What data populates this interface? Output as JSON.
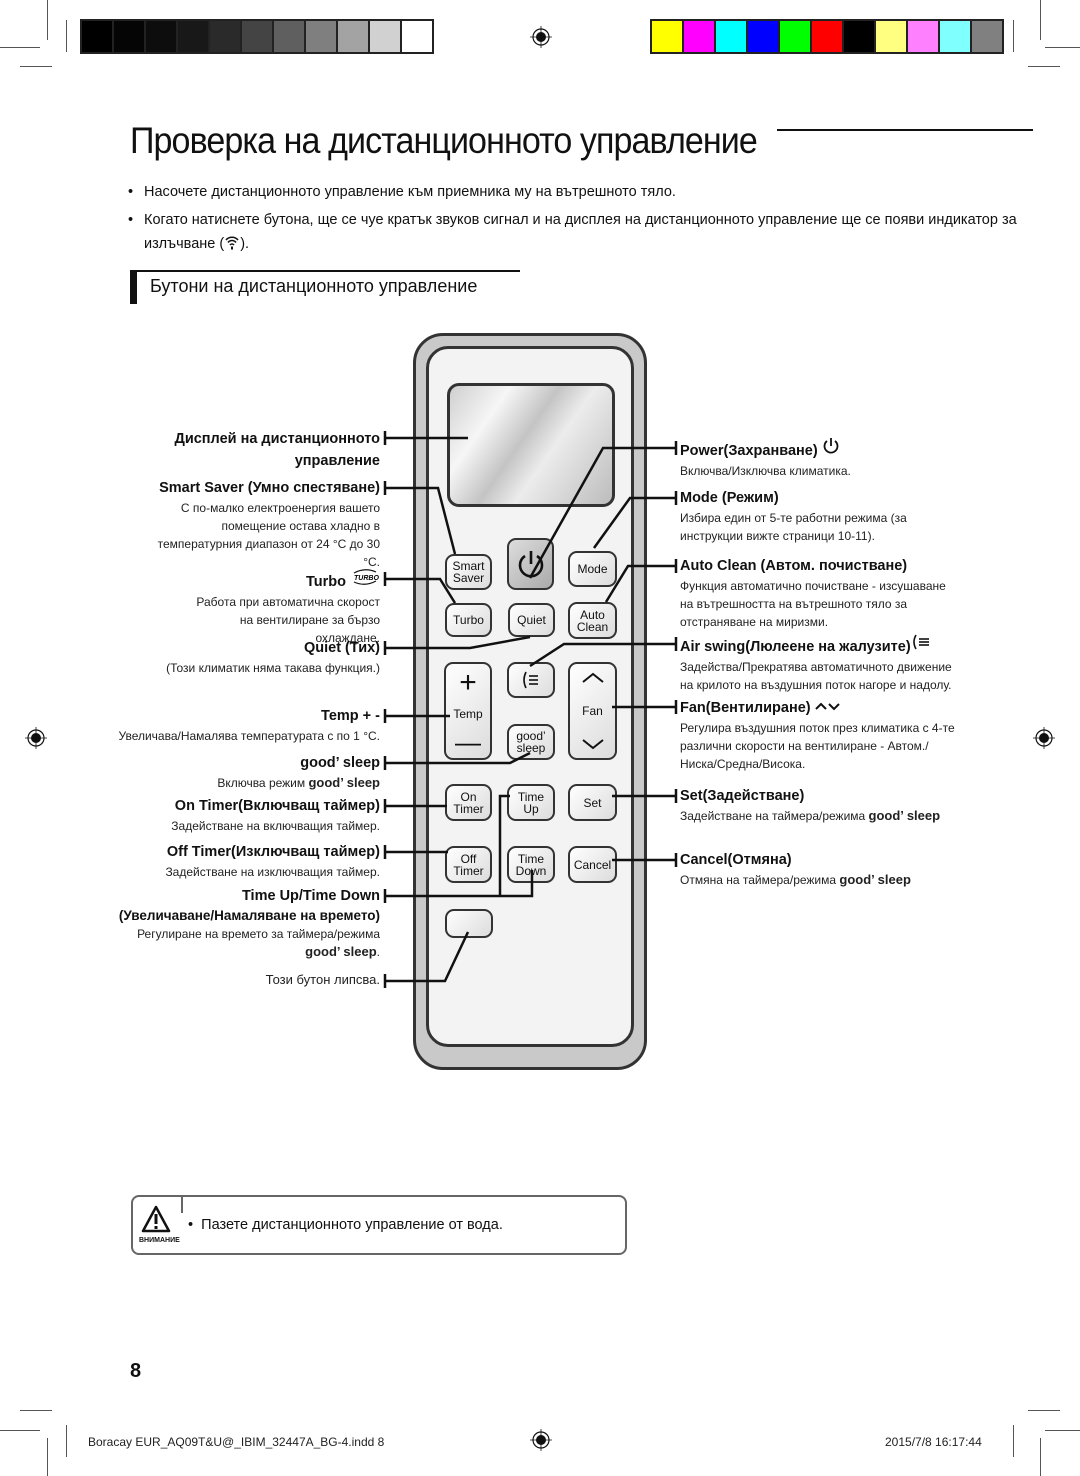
{
  "print_marks": {
    "gray_swatches": [
      "#000000",
      "#050505",
      "#0d0d0d",
      "#181818",
      "#2a2a2a",
      "#444444",
      "#5f5f5f",
      "#7f7f7f",
      "#a3a3a3",
      "#d1d1d1",
      "#ffffff"
    ],
    "color_swatches": [
      "#ffff00",
      "#ff00ff",
      "#00ffff",
      "#0000ff",
      "#00ff00",
      "#ff0000",
      "#000000",
      "#ffff80",
      "#ff80ff",
      "#80ffff",
      "#808080"
    ]
  },
  "page": {
    "title": "Проверка на дистанционното управление",
    "bullets": [
      "Насочете дистанционното управление към приемника му на вътрешното тяло.",
      "Когато натиснете бутона, ще се чуе кратък звуков сигнал и на дисплея на дистанционното управление ще се появи индикатор за излъчване (",
      ")."
    ],
    "bullet_icon": "transmit-signal-icon",
    "section_title": "Бутони на дистанционното управление"
  },
  "remote": {
    "buttons": {
      "smart_saver": "Smart Saver",
      "mode": "Mode",
      "turbo": "Turbo",
      "quiet": "Quiet",
      "auto_clean": "Auto Clean",
      "temp": "Temp",
      "temp_plus": "+",
      "temp_minus": "—",
      "fan": "Fan",
      "good_sleep": "good’ sleep",
      "on_timer": "On Timer",
      "time_up": "Time Up",
      "set": "Set",
      "off_timer": "Off Timer",
      "time_down": "Time Down",
      "cancel": "Cancel"
    }
  },
  "left_labels": [
    {
      "title": "Дисплей на дистанционното управление",
      "desc": ""
    },
    {
      "title": "Smart Saver (Умно спестяване)",
      "desc": "С по-малко електроенергия вашето помещение остава хладно в температурния диапазон от 24 °C до 30 °C."
    },
    {
      "title": "Turbo",
      "desc": "Работа при автоматична скорост на вентилиране за бързо охлаждане."
    },
    {
      "title": "Quiet (Тих)",
      "desc": "(Този климатик няма такава функция.)"
    },
    {
      "title": "Temp + -",
      "desc": "Увеличава/Намалява температурата с по 1 °C."
    },
    {
      "title": "good’ sleep",
      "desc": "Включва режим",
      "desc_bold": "good’ sleep"
    },
    {
      "title": "On Timer(Включващ таймер)",
      "desc": "Задействане на включващия таймер."
    },
    {
      "title": "Off Timer(Изключващ таймер)",
      "desc": "Задействане на изключващия таймер."
    },
    {
      "title": "Time Up/Time Down",
      "subtitle": "(Увеличаване/Намаляване на времето)",
      "desc": "Регулиране на времето за таймера/режима",
      "desc_bold": "good’ sleep",
      "desc_end": "."
    },
    {
      "title": "",
      "desc": "Този бутон липсва."
    }
  ],
  "right_labels": [
    {
      "title": "Power(Захранване)",
      "desc": "Включва/Изключва климатика."
    },
    {
      "title": "Mode (Режим)",
      "desc": "Избира един от 5-те работни режима (за инструкции вижте страници 10-11)."
    },
    {
      "title": "Auto Clean (Автом. почистване)",
      "desc": "Функция автоматично почистване - изсушаване на вътрешността на вътрешното тяло за отстраняване на миризми."
    },
    {
      "title": "Air swing(Люлеене на жалузите)",
      "desc": "Задейства/Прекратява автоматичното движение на крилото на въздушния поток нагоре и надолу."
    },
    {
      "title": "Fan(Вентилиране)",
      "desc": "Регулира въздушния поток през климатика с 4-те различни скорости на вентилиране - Автом./Ниска/Средна/Висока."
    },
    {
      "title": "Set(Задействане)",
      "desc": "Задействане на таймера/режима",
      "desc_bold": "good’ sleep"
    },
    {
      "title": "Cancel(Отмяна)",
      "desc": "Отмяна на таймера/режима",
      "desc_bold": "good’ sleep"
    }
  ],
  "warning": {
    "caption": "ВНИМАНИЕ",
    "text": "Пазете дистанционното управление от вода."
  },
  "page_number": "8",
  "footer": {
    "file": "Boracay EUR_AQ09T&U@_IBIM_32447A_BG-4.indd   8",
    "datetime": "2015/7/8   16:17:44"
  }
}
